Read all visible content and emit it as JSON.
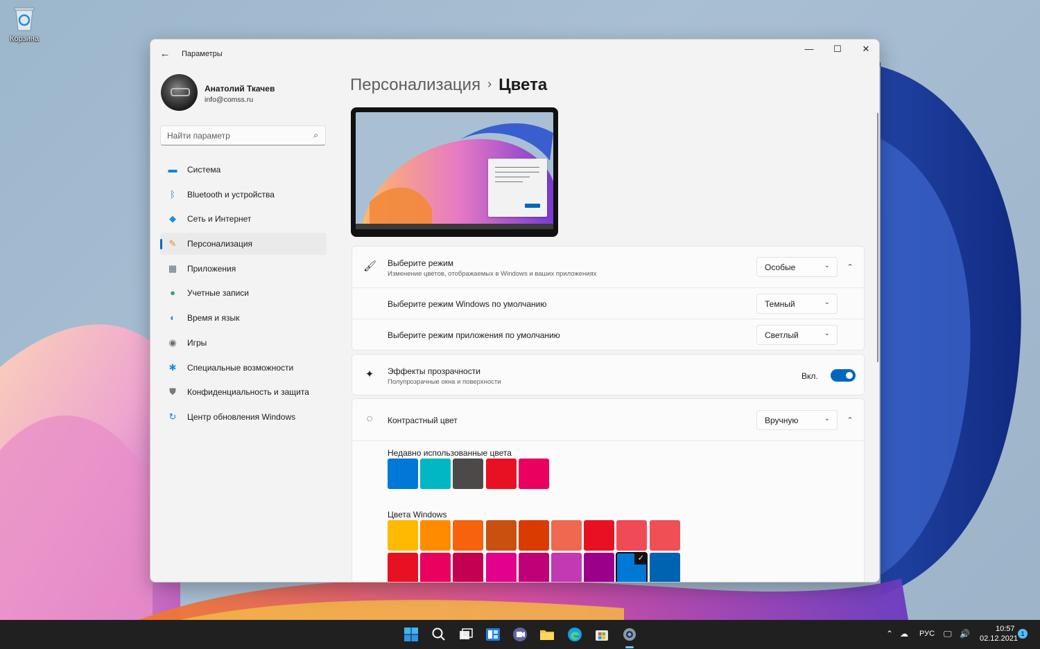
{
  "desktop": {
    "recycle_bin_label": "Корзина"
  },
  "window": {
    "title": "Параметры",
    "back_icon": "←",
    "minimize_icon": "—",
    "maximize_icon": "☐",
    "close_icon": "✕"
  },
  "profile": {
    "name": "Анатолий Ткачев",
    "email": "info@comss.ru"
  },
  "search": {
    "placeholder": "Найти параметр",
    "icon": "⌕"
  },
  "sidebar": {
    "items": [
      {
        "label": "Система",
        "icon": "▬",
        "color": "#0a84d8"
      },
      {
        "label": "Bluetooth и устройства",
        "icon": "ᛒ",
        "color": "#0a84d8"
      },
      {
        "label": "Сеть и Интернет",
        "icon": "◆",
        "color": "#1b8fe0"
      },
      {
        "label": "Персонализация",
        "icon": "✎",
        "color": "#e08a3c",
        "active": true
      },
      {
        "label": "Приложения",
        "icon": "▦",
        "color": "#5a6b7a"
      },
      {
        "label": "Учетные записи",
        "icon": "●",
        "color": "#2aa37e"
      },
      {
        "label": "Время и язык",
        "icon": "◐",
        "color": "#1b8fe0"
      },
      {
        "label": "Игры",
        "icon": "◉",
        "color": "#6b6b6b"
      },
      {
        "label": "Специальные возможности",
        "icon": "✱",
        "color": "#1b8fe0"
      },
      {
        "label": "Конфиденциальность и защита",
        "icon": "⛊",
        "color": "#7a7a7a"
      },
      {
        "label": "Центр обновления Windows",
        "icon": "↻",
        "color": "#0a84d8"
      }
    ]
  },
  "breadcrumb": {
    "parent": "Персонализация",
    "separator": "›",
    "current": "Цвета"
  },
  "mode_card": {
    "title": "Выберите режим",
    "subtitle": "Изменение цветов, отображаемых в Windows и ваших приложениях",
    "value": "Особые",
    "icon": "🖌",
    "windows_mode_label": "Выберите режим Windows по умолчанию",
    "windows_mode_value": "Темный",
    "app_mode_label": "Выберите режим приложения по умолчанию",
    "app_mode_value": "Светлый"
  },
  "transparency_card": {
    "title": "Эффекты прозрачности",
    "subtitle": "Полупрозрачные окна и поверхности",
    "toggle_label": "Вкл.",
    "enabled": true
  },
  "accent_card": {
    "title": "Контрастный цвет",
    "value": "Вручную",
    "recent_label": "Недавно использованные цвета",
    "recent_colors": [
      "#0078d7",
      "#00b7c3",
      "#4c4a48",
      "#e81123",
      "#ea005e"
    ],
    "windows_label": "Цвета Windows",
    "windows_colors_row1": [
      "#ffb900",
      "#ff8c00",
      "#f7630c",
      "#ca5010",
      "#da3b01",
      "#ef6950",
      "#e81123",
      "#ef4a56",
      "#f04f55"
    ],
    "windows_colors_row2": [
      "#e81123",
      "#ea005e",
      "#c30052",
      "#e3008c",
      "#bf0077",
      "#c239b3",
      "#9a0089",
      "#0078d7",
      "#0063b1"
    ],
    "selected_color": "#0078d7",
    "chevron_icon": "⌄",
    "collapse_icon": "⌃"
  },
  "taskbar": {
    "language": "РУС",
    "time": "10:57",
    "date": "02.12.2021",
    "notification_count": "1"
  }
}
